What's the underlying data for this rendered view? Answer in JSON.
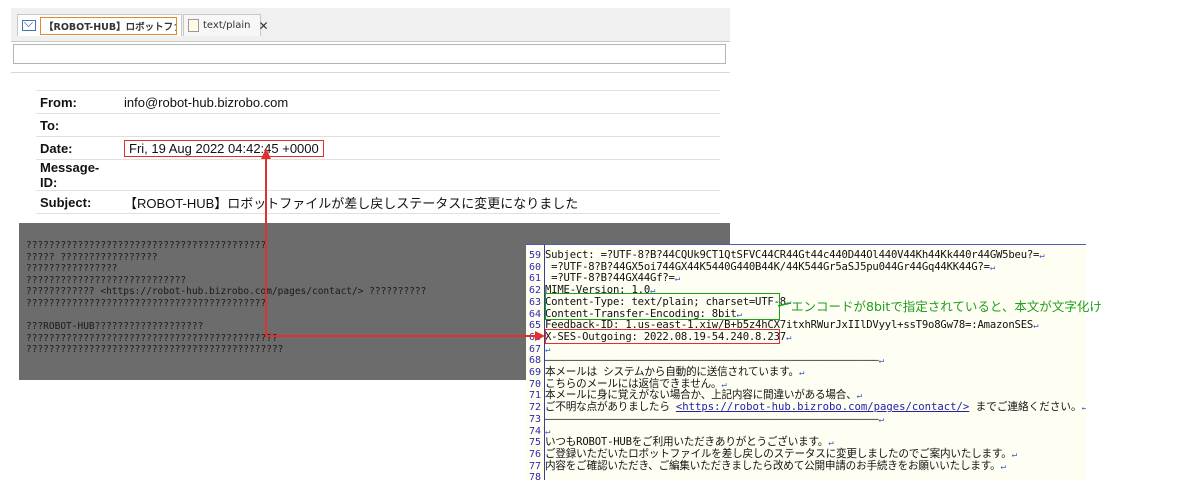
{
  "tabs": [
    {
      "label": "【ROBOT-HUB】ロボットファ..."
    },
    {
      "label": "text/plain"
    }
  ],
  "headers": [
    {
      "key": "From:",
      "value": "info@robot-hub.bizrobo.com"
    },
    {
      "key": "To:",
      "value": ""
    },
    {
      "key": "Date:",
      "value": "Fri, 19 Aug 2022 04:42:45 +0000"
    },
    {
      "key": "Message-ID:",
      "value": ""
    },
    {
      "key": "Subject:",
      "value": "【ROBOT-HUB】ロボットファイルが差し戻しステータスに変更になりました"
    }
  ],
  "body_lines": [
    "??????????????????????????????????????????",
    "????? ?????????????????",
    "????????????????",
    "????????????????????????????",
    "???????????? <https://robot-hub.bizrobo.com/pages/contact/> ??????????",
    "??????????????????????????????????????????",
    "",
    "???ROBOT-HUB???????????????????",
    "????????????????????????????????????????????",
    "?????????????????????????????????????????????"
  ],
  "source_lines": [
    {
      "num": "59",
      "text": "Subject: =?UTF-8?B?44CQUk9CT1QtSFVC44CR44Gt44c440D44Ol440V44Kh44Kk440r44GW5beu?="
    },
    {
      "num": "60",
      "text": " =?UTF-8?B?44GX5oi744GX44K5440G440B44K/44K544Gr5aSJ5pu044Gr44Gq44KK44G?="
    },
    {
      "num": "61",
      "text": " =?UTF-8?B?44GX44Gf?="
    },
    {
      "num": "62",
      "text": "MIME-Version: 1.0"
    },
    {
      "num": "63",
      "text": "Content-Type: text/plain; charset=UTF-8"
    },
    {
      "num": "64",
      "text": "Content-Transfer-Encoding: 8bit"
    },
    {
      "num": "65",
      "text": "Feedback-ID: 1.us-east-1.xiw/B+b5z4hCX7itxhRWurJxIIlDVyyl+ssT9o8Gw78=:AmazonSES"
    },
    {
      "num": "66",
      "text": "X-SES-Outgoing: 2022.08.19-54.240.8.237"
    },
    {
      "num": "67",
      "text": ""
    },
    {
      "num": "68",
      "text": "——————————————————————————————————————————————————————"
    },
    {
      "num": "69",
      "text": "本メールは システムから自動的に送信されています。"
    },
    {
      "num": "70",
      "text": "こちらのメールには返信できません。"
    },
    {
      "num": "71",
      "text": "本メールに身に覚えがない場合か、上記内容に間違いがある場合、"
    },
    {
      "num": "72",
      "text": "ご不明な点がありましたら "
    },
    {
      "num": "73",
      "text": "——————————————————————————————————————————————————————"
    },
    {
      "num": "74",
      "text": ""
    },
    {
      "num": "75",
      "text": "いつもROBOT-HUBをご利用いただきありがとうございます。"
    },
    {
      "num": "76",
      "text": "ご登録いただいたロボットファイルを差し戻しのステータスに変更しましたのでご案内いたします。"
    },
    {
      "num": "77",
      "text": "内容をご確認いただき、ご編集いただきましたら改めて公開申請のお手続きをお願いいたします。"
    },
    {
      "num": "78",
      "text": ""
    }
  ],
  "line72_link": "<https://robot-hub.bizrobo.com/pages/contact/>",
  "line72_tail": " までご連絡ください。",
  "eol_mark": "↵",
  "callout": "エンコードが8bitで指定されていると、本文が文字化け",
  "colors": {
    "highlight_red": "#e03030",
    "highlight_green": "#19a219",
    "callout_text": "#1e9e1e"
  }
}
